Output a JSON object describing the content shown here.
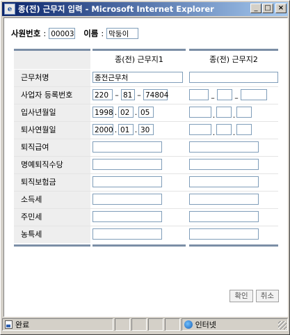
{
  "window": {
    "title": "종(전) 근무지 입력 - Microsoft Internet Explorer",
    "controls": {
      "minimize": "_",
      "maximize": "□",
      "close": "×"
    }
  },
  "header": {
    "emp_no_label": "사원번호",
    "emp_no_value": "00003",
    "name_label": "이름",
    "name_value": "막둥이",
    "colon": ":"
  },
  "table": {
    "col1": "종(전) 근무지1",
    "col2": "종(전) 근무지2",
    "rows": {
      "workplace": {
        "label": "근무처명",
        "c1": "종전근무처",
        "c2": ""
      },
      "bizno": {
        "label": "사업자 등록번호",
        "c1": [
          "220",
          "81",
          "74804"
        ],
        "c2": [
          "",
          "",
          ""
        ]
      },
      "hire": {
        "label": "입사년월일",
        "c1": [
          "1998",
          "02",
          "05"
        ],
        "c2": [
          "",
          "",
          ""
        ]
      },
      "retire": {
        "label": "퇴사연월일",
        "c1": [
          "2000",
          "01",
          "30"
        ],
        "c2": [
          "",
          "",
          ""
        ]
      },
      "severance": {
        "label": "퇴직급여",
        "c1": "",
        "c2": ""
      },
      "honor": {
        "label": "명예퇴직수당",
        "c1": "",
        "c2": ""
      },
      "insurance": {
        "label": "퇴직보험금",
        "c1": "",
        "c2": ""
      },
      "income_tax": {
        "label": "소득세",
        "c1": "",
        "c2": ""
      },
      "resident_tax": {
        "label": "주민세",
        "c1": "",
        "c2": ""
      },
      "rural_tax": {
        "label": "농특세",
        "c1": "",
        "c2": ""
      }
    },
    "dash": "–",
    "dot": "."
  },
  "buttons": {
    "confirm": "확인",
    "cancel": "취소"
  },
  "statusbar": {
    "left": "완료",
    "zone": "인터넷"
  },
  "colors": {
    "title_start": "#0a246a",
    "title_end": "#a6caf0",
    "label_bg": "#eeeeee",
    "bar": "#7b8ea6"
  }
}
